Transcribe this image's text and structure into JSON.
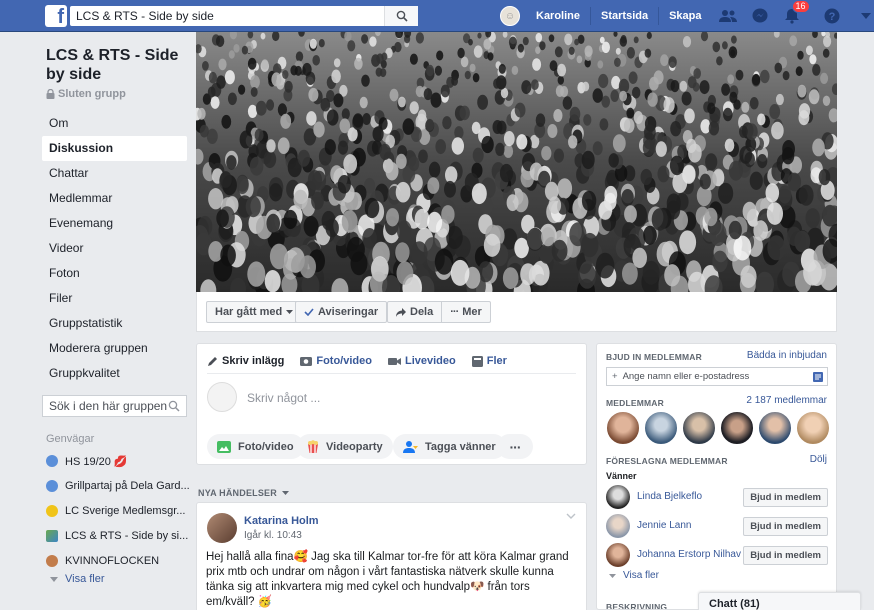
{
  "topbar": {
    "search_value": "LCS & RTS - Side by side",
    "user_name": "Karoline",
    "home_label": "Startsida",
    "create_label": "Skapa",
    "notification_count": "16",
    "brand_color": "#4267b2"
  },
  "group": {
    "title": "LCS & RTS - Side by side",
    "privacy": "Sluten grupp"
  },
  "nav": {
    "items": [
      "Om",
      "Diskussion",
      "Chattar",
      "Medlemmar",
      "Evenemang",
      "Videor",
      "Foton",
      "Filer",
      "Gruppstatistik",
      "Moderera gruppen",
      "Gruppkvalitet"
    ],
    "active": "Diskussion"
  },
  "side_search": {
    "placeholder": "Sök i den här gruppen"
  },
  "shortcuts": {
    "title": "Genvägar",
    "items": [
      {
        "label": "HS 19/20 💋",
        "color": "#5b8fd9"
      },
      {
        "label": "Grillpartaj på Dela Gard...",
        "color": "#5b8fd9"
      },
      {
        "label": "LC Sverige Medlemsgr...",
        "color": "#f0c419"
      },
      {
        "label": "LCS & RTS - Side by si...",
        "color": "#6aa84f"
      },
      {
        "label": "KVINNOFLOCKEN",
        "color": "#c27c4b"
      }
    ],
    "show_more": "Visa fler"
  },
  "actions": {
    "joined": "Har gått med",
    "notifications": "Aviseringar",
    "share": "Dela",
    "more": "Mer"
  },
  "composer": {
    "tabs": [
      "Skriv inlägg",
      "Foto/video",
      "Livevideo",
      "Fler"
    ],
    "placeholder": "Skriv något ...",
    "buttons": [
      "Foto/video",
      "Videoparty",
      "Tagga vänner"
    ]
  },
  "feed": {
    "header": "NYA HÄNDELSER",
    "post": {
      "author": "Katarina Holm",
      "time": "Igår kl. 10:43",
      "text": "Hej hallå alla fina🥰 Jag ska till Kalmar tor-fre för att köra Kalmar grand prix mtb och undrar om någon i vårt fantastiska nätverk skulle kunna tänka sig att inkvartera mig med cykel och hundvalp🐶 från tors em/kväll? 🥳"
    }
  },
  "right": {
    "invite_label": "BJUD IN MEDLEMMAR",
    "invite_link": "Bädda in inbjudan",
    "invite_placeholder": "Ange namn eller e-postadress",
    "members_label": "MEDLEMMAR",
    "members_count": "2 187 medlemmar",
    "suggested_label": "FÖRESLAGNA MEDLEMMAR",
    "hide_label": "Dölj",
    "friends_label": "Vänner",
    "suggestions": [
      {
        "name": "Linda Bjelkeflo",
        "button": "Bjud in medlem"
      },
      {
        "name": "Jennie Lann",
        "button": "Bjud in medlem"
      },
      {
        "name": "Johanna Erstorp Nilhav",
        "button": "Bjud in medlem"
      }
    ],
    "show_more": "Visa fler",
    "description_label": "BESKRIVNING"
  },
  "chat": {
    "label": "Chatt (81)"
  }
}
